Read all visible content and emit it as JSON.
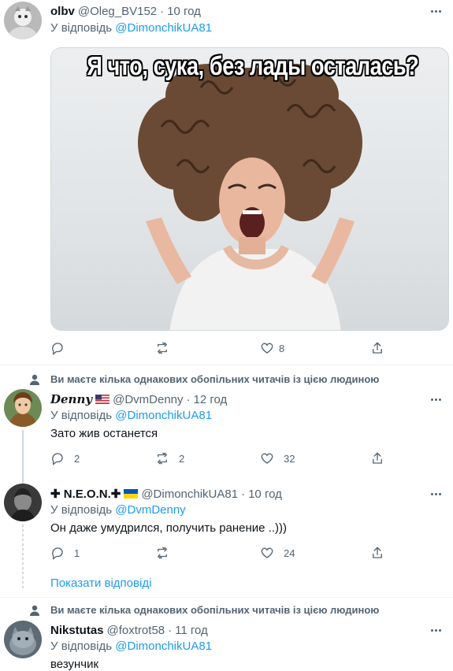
{
  "tweet1": {
    "name": "olbv",
    "handle": "@Oleg_BV152",
    "dot": "·",
    "time": "10 год",
    "reply_prefix": "У відповідь",
    "reply_to": "@DimonchikUA81",
    "image_caption": "Я что, сука, без лады осталась?",
    "replies": "",
    "retweets": "",
    "likes": "8"
  },
  "social1": {
    "text": "Ви маєте кілька однакових обопільних читачів із цією людиною"
  },
  "tweet2": {
    "name": "Denny",
    "handle": "@DvmDenny",
    "dot": "·",
    "time": "12 год",
    "reply_prefix": "У відповідь",
    "reply_to": "@DimonchikUA81",
    "text": "Зато жив останется",
    "replies": "2",
    "retweets": "2",
    "likes": "32"
  },
  "tweet3": {
    "name": "✚ N.E.O.N.✚",
    "handle": "@DimonchikUA81",
    "dot": "·",
    "time": "10 год",
    "reply_prefix": "У відповідь",
    "reply_to": "@DvmDenny",
    "text": "Он даже умудрился, получить ранение ..)))",
    "replies": "1",
    "retweets": "",
    "likes": "24"
  },
  "show_replies": "Показати відповіді",
  "social2": {
    "text": "Ви маєте кілька однакових обопільних читачів із цією людиною"
  },
  "tweet4": {
    "name": "Nikstutas",
    "handle": "@foxtrot58",
    "dot": "·",
    "time": "11 год",
    "reply_prefix": "У відповідь",
    "reply_to": "@DimonchikUA81",
    "text": "везунчик"
  },
  "colors": {
    "accent": "#1d9bf0",
    "secondary_text": "#536471",
    "divider": "#eff3f4"
  }
}
